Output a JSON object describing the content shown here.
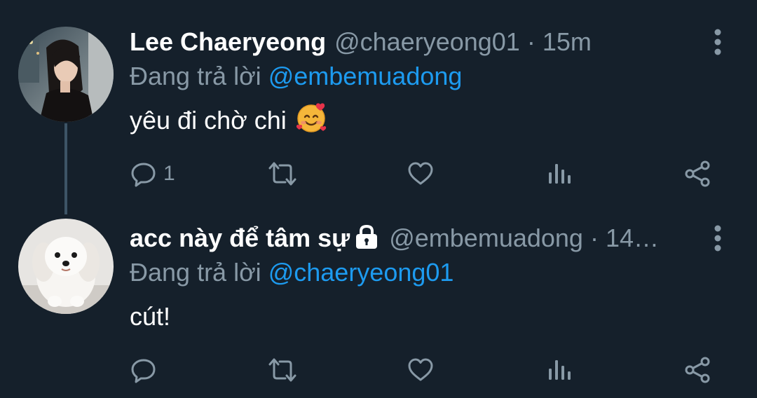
{
  "tweets": [
    {
      "name": "Lee Chaeryeong",
      "handle": "@chaeryeong01",
      "separator": "·",
      "time": "15m",
      "replying_prefix": "Đang trả lời",
      "replying_to": "@embemuadong",
      "text": "yêu đi chờ chi",
      "emoji": "smiling-face-with-hearts",
      "reply_count": "1",
      "avatar": "woman-portrait"
    },
    {
      "name": "acc này để tâm sự",
      "handle": "@embemuadong",
      "separator": "·",
      "time": "14…",
      "replying_prefix": "Đang trả lời",
      "replying_to": "@chaeryeong01",
      "text": "cút!",
      "reply_count": "",
      "avatar": "white-puppy",
      "protected": true
    }
  ],
  "colors": {
    "background": "#15202b",
    "text": "#ffffff",
    "secondary": "#8899a6",
    "accent": "#1d9bf0",
    "thread_line": "#3d5466"
  },
  "icons": [
    "reply-icon",
    "retweet-icon",
    "like-icon",
    "analytics-icon",
    "share-icon",
    "more-icon",
    "lock-icon"
  ]
}
